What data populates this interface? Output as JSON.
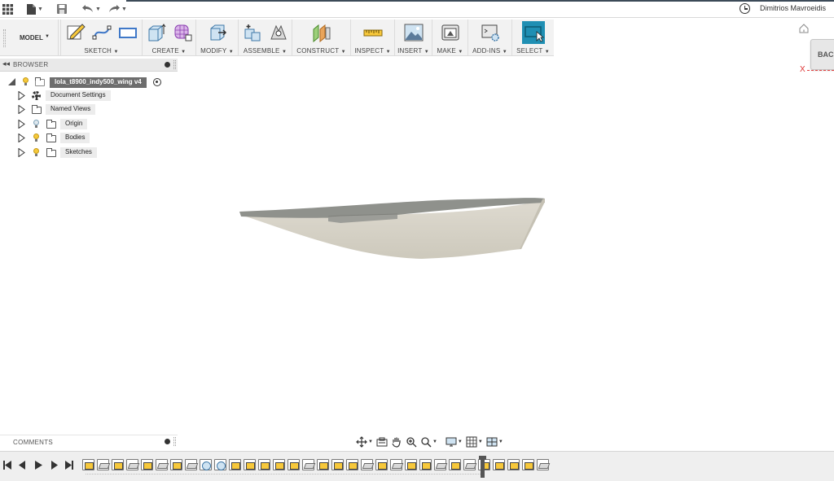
{
  "quick_access": {
    "user_name": "Dimitrios Mavroeidis"
  },
  "toolbar": {
    "workspace": "MODEL",
    "groups": [
      {
        "label": "SKETCH"
      },
      {
        "label": "CREATE"
      },
      {
        "label": "MODIFY"
      },
      {
        "label": "ASSEMBLE"
      },
      {
        "label": "CONSTRUCT"
      },
      {
        "label": "INSPECT"
      },
      {
        "label": "INSERT"
      },
      {
        "label": "MAKE"
      },
      {
        "label": "ADD-INS"
      },
      {
        "label": "SELECT"
      }
    ],
    "caret": "▾"
  },
  "browser": {
    "title": "BROWSER",
    "root": "lola_t8900_indy500_wing v4",
    "items": [
      {
        "label": "Document Settings",
        "icon": "gear-icon"
      },
      {
        "label": "Named Views",
        "icon": "folder-icon"
      },
      {
        "label": "Origin",
        "icon": "folder-icon",
        "visibility": "hidden-bulb"
      },
      {
        "label": "Bodies",
        "icon": "folder-icon",
        "visibility": "on-bulb"
      },
      {
        "label": "Sketches",
        "icon": "folder-icon",
        "visibility": "on-bulb"
      }
    ]
  },
  "viewcube": {
    "face_label": "BACK",
    "axis_label": "X"
  },
  "comments": {
    "title": "COMMENTS"
  },
  "colors": {
    "select_active": "#1f8fb3",
    "sketch_yellow": "#f7c83b",
    "model_top": "#8f918c",
    "model_side": "#d9d6cb"
  },
  "timeline": {
    "features": [
      "sk",
      "pl",
      "sk",
      "pl",
      "sk",
      "pl",
      "sk",
      "pl",
      "rv",
      "rv",
      "sk",
      "sk",
      "sk",
      "sk",
      "sk",
      "pl",
      "sk",
      "sk",
      "sk",
      "pl",
      "sk",
      "pl",
      "sk",
      "sk",
      "pl",
      "sk",
      "pl",
      "sk",
      "sk",
      "sk",
      "sk",
      "pl"
    ]
  }
}
